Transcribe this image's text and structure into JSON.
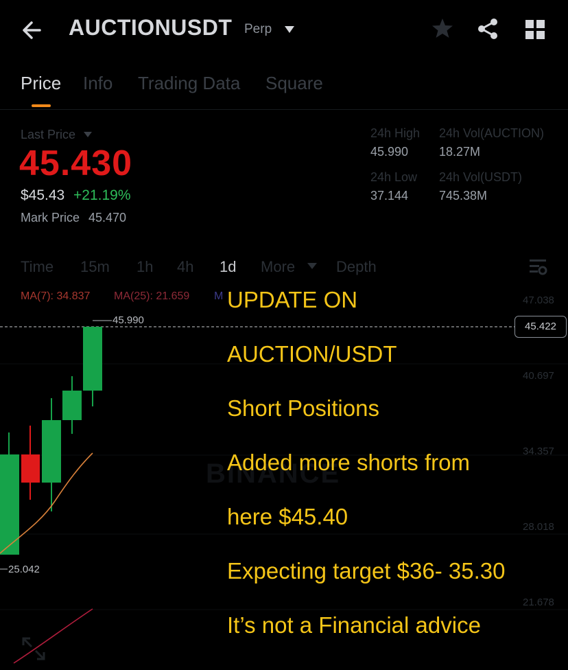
{
  "header": {
    "pair": "AUCTIONUSDT",
    "contract_type": "Perp"
  },
  "tabs": [
    "Price",
    "Info",
    "Trading Data",
    "Square"
  ],
  "price": {
    "last_price_label": "Last Price",
    "last_price": "45.430",
    "usd_price": "$45.43",
    "change_pct": "+21.19%",
    "mark_price_label": "Mark Price",
    "mark_price": "45.470"
  },
  "stats": {
    "high_label": "24h High",
    "high": "45.990",
    "low_label": "24h Low",
    "low": "37.144",
    "vol_base_label": "24h Vol(AUCTION)",
    "vol_base": "18.27M",
    "vol_quote_label": "24h Vol(USDT)",
    "vol_quote": "745.38M"
  },
  "intervals": [
    "Time",
    "15m",
    "1h",
    "4h",
    "1d",
    "More",
    "Depth"
  ],
  "ma": {
    "ma7": "MA(7): 34.837",
    "ma25": "MA(25): 21.659",
    "ma99": "M"
  },
  "chart": {
    "y_ticks": [
      "47.038",
      "40.697",
      "34.357",
      "28.018",
      "21.678"
    ],
    "current_price_tag": "45.422",
    "high_marker": "45.990",
    "low_marker": "25.042",
    "watermark": "BINANCE"
  },
  "overlay": {
    "lines": [
      "UPDATE ON",
      "AUCTION/USDT",
      "Short Positions",
      "Added more shorts from",
      "here $45.40",
      "Expecting target $36- 35.30",
      "It’s not a Financial advice"
    ]
  },
  "colors": {
    "up": "#16a34a",
    "down": "#e01a1a",
    "accent": "#f0891a",
    "overlay_text": "#f5c518"
  }
}
